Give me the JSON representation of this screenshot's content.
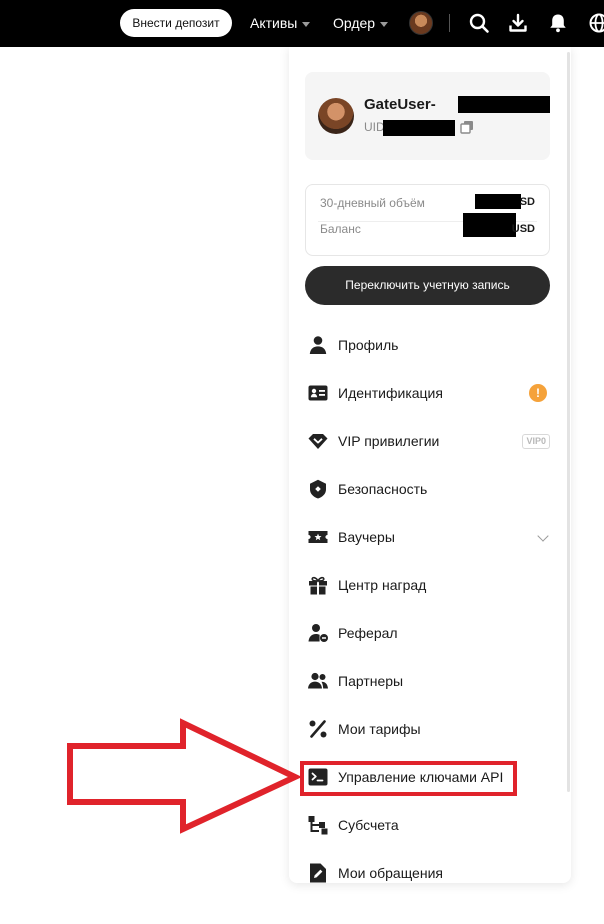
{
  "topbar": {
    "deposit_label": "Внести депозит",
    "assets_label": "Активы",
    "orders_label": "Ордер",
    "icons": [
      "avatar",
      "search-icon",
      "download-icon",
      "bell-icon",
      "globe-icon"
    ]
  },
  "user": {
    "name_prefix": "GateUser-",
    "uid_label": "UID"
  },
  "stats": {
    "volume_label": "30-дневный объём",
    "volume_suffix": "SD",
    "balance_label": "Баланс",
    "balance_suffix": "USD"
  },
  "switch_account_label": "Переключить учетную запись",
  "menu": {
    "items": [
      {
        "label": "Профиль",
        "icon": "user-icon"
      },
      {
        "label": "Идентификация",
        "icon": "id-card-icon",
        "badge": "!"
      },
      {
        "label": "VIP привилегии",
        "icon": "vip-diamond-icon",
        "tag": "VIP0"
      },
      {
        "label": "Безопасность",
        "icon": "shield-icon"
      },
      {
        "label": "Ваучеры",
        "icon": "ticket-icon"
      },
      {
        "label": "Центр наград",
        "icon": "gift-icon"
      },
      {
        "label": "Реферал",
        "icon": "referral-icon"
      },
      {
        "label": "Партнеры",
        "icon": "partners-icon"
      },
      {
        "label": "Мои тарифы",
        "icon": "percent-icon"
      },
      {
        "label": "Управление ключами API",
        "icon": "terminal-icon"
      },
      {
        "label": "Субсчета",
        "icon": "subaccounts-icon"
      },
      {
        "label": "Мои обращения",
        "icon": "edit-doc-icon"
      }
    ]
  },
  "colors": {
    "topbar_bg": "#000000",
    "accent_warning": "#f5a23a",
    "annotation_red": "#e0232b",
    "button_dark": "#2b2b2b"
  }
}
